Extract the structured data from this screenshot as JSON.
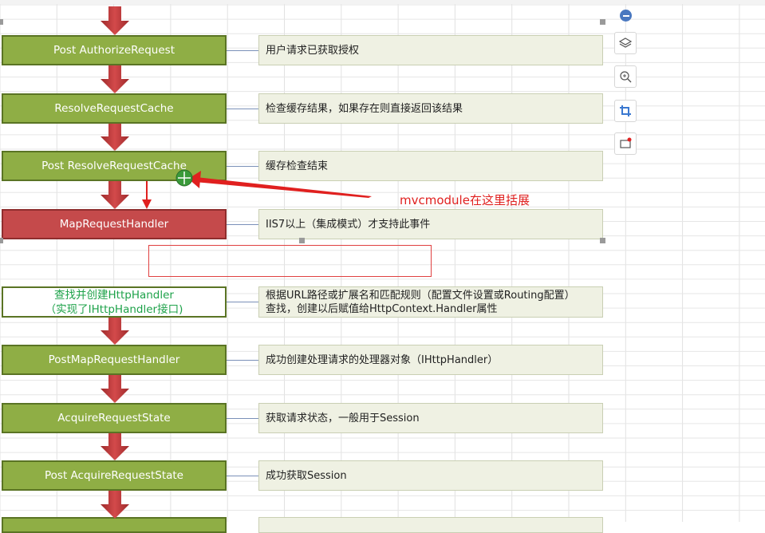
{
  "flow": [
    {
      "label": "Post AuthorizeRequest",
      "note": [
        "用户请求已获取授权"
      ]
    },
    {
      "label": "ResolveRequestCache",
      "note": [
        "检查缓存结果，如果存在则直接返回该结果"
      ]
    },
    {
      "label": "Post ResolveRequestCache",
      "note": [
        "缓存检查结束"
      ]
    },
    {
      "label": "MapRequestHandler",
      "note": [
        "IIS7以上（集成模式）才支持此事件"
      ]
    },
    {
      "label_lines": [
        "查找并创建HttpHandler",
        "（实现了IHttpHandler接口)"
      ],
      "note": [
        "根据URL路径或扩展名和匹配规则（配置文件设置或Routing配置）",
        "查找，创建以后赋值给HttpContext.Handler属性"
      ]
    },
    {
      "label": "PostMapRequestHandler",
      "note": [
        "成功创建处理请求的处理器对象（IHttpHandler）"
      ]
    },
    {
      "label": "AcquireRequestState",
      "note": [
        "获取请求状态，一般用于Session"
      ]
    },
    {
      "label": "Post AcquireRequestState",
      "note": [
        "成功获取Session"
      ]
    }
  ],
  "annotation": "mvcmodule在这里括展",
  "toolbar": [
    "collapse-icon",
    "layers-icon",
    "zoom-in-icon",
    "crop-icon",
    "record-icon"
  ],
  "colors": {
    "box_green": "#8fae45",
    "box_red": "#c54a4b",
    "arrow": "#c0393b",
    "annotation": "#e0201f",
    "note_bg": "#eff1e3"
  }
}
